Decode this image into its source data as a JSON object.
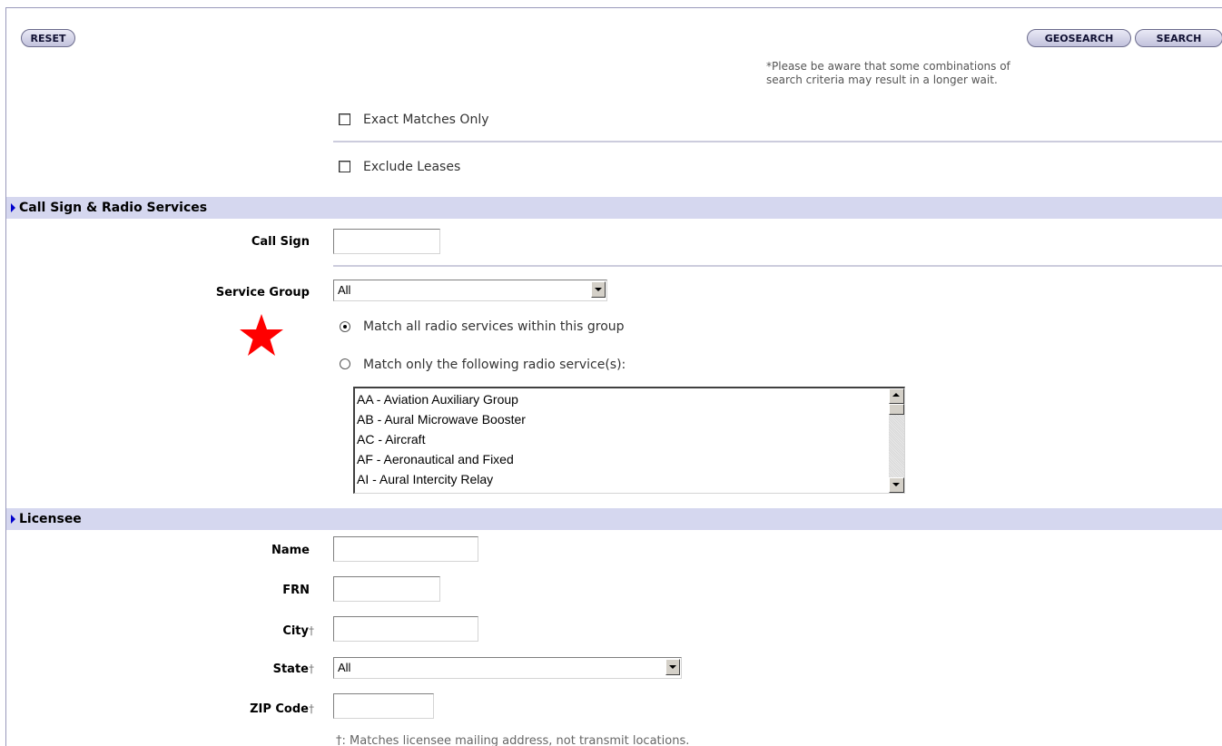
{
  "toolbar": {
    "reset_label": "RESET",
    "geosearch_label": "GEOSEARCH",
    "search_label": "SEARCH"
  },
  "wait_note": {
    "line1": "*Please be aware that some combinations of",
    "line2": "search criteria may result in a longer wait."
  },
  "options": {
    "exact_matches": {
      "label": "Exact Matches Only",
      "checked": false
    },
    "exclude_leases": {
      "label": "Exclude Leases",
      "checked": false
    }
  },
  "call_sign_section": {
    "title": "Call Sign & Radio Services",
    "call_sign": {
      "label": "Call Sign",
      "value": ""
    },
    "service_group": {
      "label": "Service Group",
      "selected": "All",
      "radio_all": {
        "label": "Match all radio services within this group",
        "selected": true
      },
      "radio_only": {
        "label": "Match only the following radio service(s):",
        "selected": false
      },
      "services": [
        "AA - Aviation Auxiliary Group",
        "AB - Aural Microwave Booster",
        "AC - Aircraft",
        "AF - Aeronautical and Fixed",
        "AI - Aural Intercity Relay"
      ]
    }
  },
  "licensee_section": {
    "title": "Licensee",
    "name": {
      "label": "Name",
      "value": ""
    },
    "frn": {
      "label": "FRN",
      "value": ""
    },
    "city": {
      "label": "City",
      "value": ""
    },
    "state": {
      "label": "State",
      "selected": "All"
    },
    "zip": {
      "label": "ZIP Code",
      "value": ""
    },
    "dagger_mark": "†",
    "footnote": "†: Matches licensee mailing address, not transmit locations."
  },
  "colors": {
    "section_bar": "#d5d7ef",
    "star_marker": "#ff0000",
    "section_arrow": "#0000cc"
  },
  "icons": {
    "star": "star-icon",
    "section_arrow": "caret-right-icon",
    "dropdown": "chevron-down-icon",
    "scroll_up": "chevron-up-icon"
  }
}
